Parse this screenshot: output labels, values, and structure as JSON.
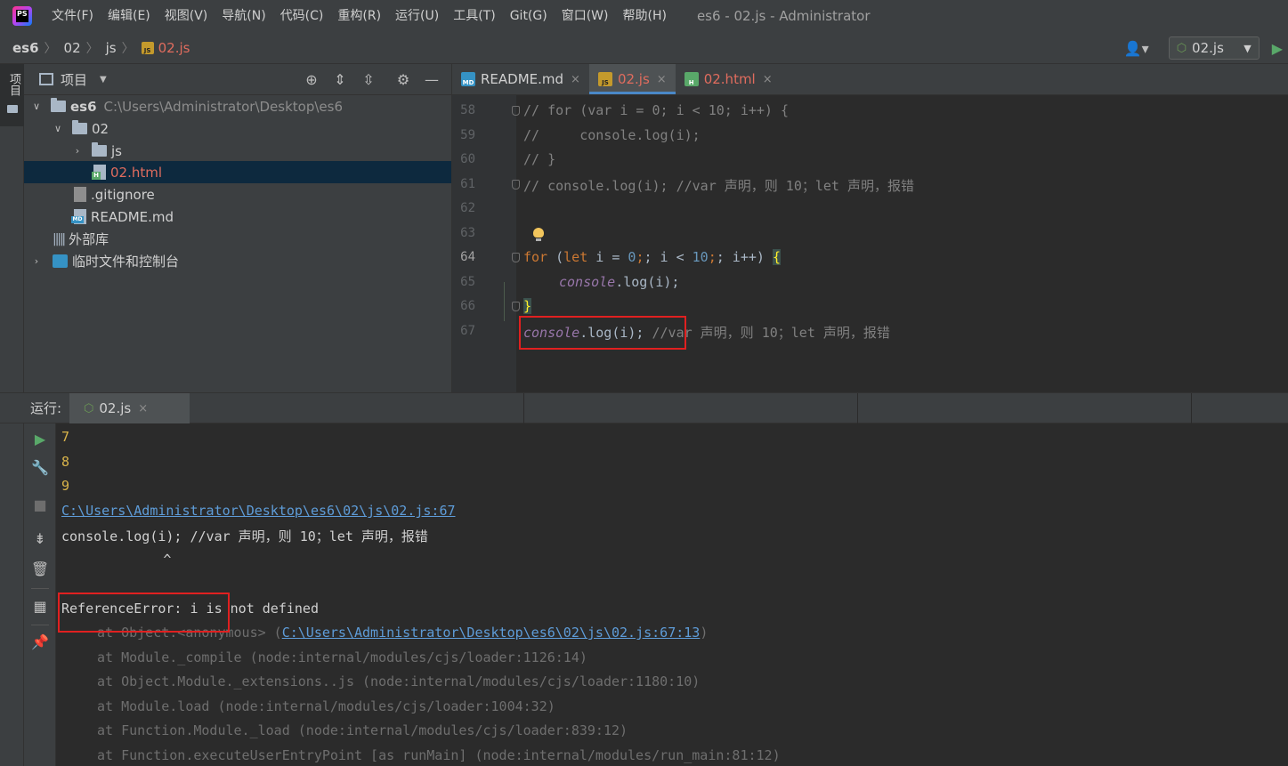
{
  "menubar": {
    "items": [
      "文件(F)",
      "编辑(E)",
      "视图(V)",
      "导航(N)",
      "代码(C)",
      "重构(R)",
      "运行(U)",
      "工具(T)",
      "Git(G)",
      "窗口(W)",
      "帮助(H)"
    ],
    "window_title": "es6 - 02.js - Administrator",
    "logo_text": "PS"
  },
  "breadcrumb": [
    "es6",
    "02",
    "js",
    "02.js"
  ],
  "toolbar": {
    "run_config": "02.js"
  },
  "left_strip": {
    "project_tab": "项目"
  },
  "project": {
    "title": "项目",
    "tree": [
      {
        "label": "es6",
        "path": "C:\\Users\\Administrator\\Desktop\\es6"
      },
      {
        "label": "02"
      },
      {
        "label": "js"
      },
      {
        "label": "02.html"
      },
      {
        "label": ".gitignore"
      },
      {
        "label": "README.md"
      },
      {
        "label": "外部库"
      },
      {
        "label": "临时文件和控制台"
      }
    ]
  },
  "editor": {
    "tabs": [
      {
        "label": "README.md",
        "icon": "md-file-icon"
      },
      {
        "label": "02.js",
        "icon": "js-file-icon"
      },
      {
        "label": "02.html",
        "icon": "html-file-icon"
      }
    ],
    "line_numbers": [
      "58",
      "59",
      "60",
      "61",
      "62",
      "63",
      "64",
      "65",
      "66",
      "67"
    ],
    "lines": {
      "l58": "// for (var i = 0; i < 10; i++) {",
      "l59": "//     console.log(i);",
      "l60": "// }",
      "l61": "// console.log(i); //var 声明，则 10；let 声明，报错",
      "l64_kw1": "for",
      "l64_p1": " (",
      "l64_kw2": "let",
      "l64_p2": " i = ",
      "l64_n1": "0",
      "l64_p3": "; i < ",
      "l64_n2": "10",
      "l64_p4": "; i++) ",
      "l64_brace": "{",
      "l65_console": "console",
      "l65_rest": ".log(i);",
      "l66_brace": "}",
      "l67_console": "console",
      "l67_rest": ".log(i); ",
      "l67_comment": "//var 声明，则 10；let 声明，报错"
    }
  },
  "run": {
    "label": "运行:",
    "tab": "02.js",
    "output": {
      "n7": "7",
      "n8": "8",
      "n9": "9",
      "file_link": "C:\\Users\\Administrator\\Desktop\\es6\\02\\js\\02.js:67",
      "source_line": "console.log(i); //var 声明，则 10；let 声明，报错",
      "caret": "              ^",
      "error": "ReferenceError: i is not defined",
      "stack0_pre": "at Object.<anonymous> (",
      "stack0_link": "C:\\Users\\Administrator\\Desktop\\es6\\02\\js\\02.js:67:13",
      "stack0_post": ")",
      "stack": [
        "at Module._compile (node:internal/modules/cjs/loader:1126:14)",
        "at Object.Module._extensions..js (node:internal/modules/cjs/loader:1180:10)",
        "at Module.load (node:internal/modules/cjs/loader:1004:32)",
        "at Function.Module._load (node:internal/modules/cjs/loader:839:12)",
        "at Function.executeUserEntryPoint [as runMain] (node:internal/modules/run_main:81:12)"
      ]
    }
  },
  "colors": {
    "background": "#2b2b2b",
    "panel": "#3c3f41",
    "accent": "#4a88c7",
    "highlight_box": "#e02020",
    "link": "#5e9cd8"
  }
}
